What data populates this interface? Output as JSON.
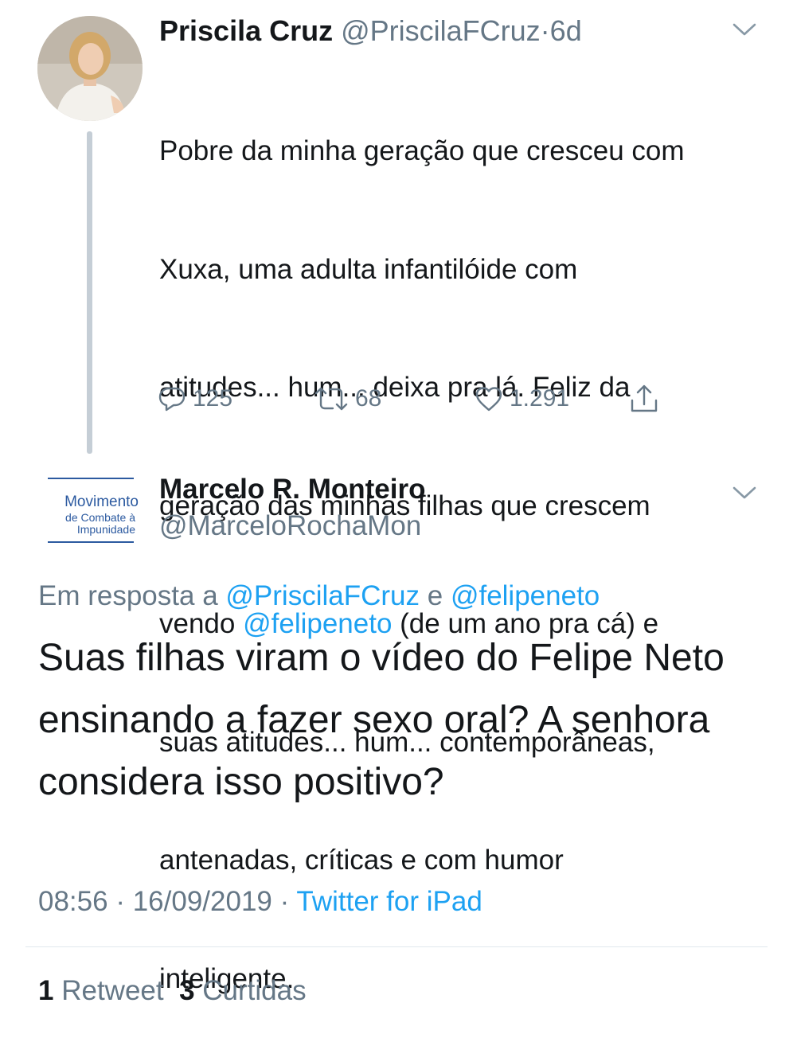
{
  "tweet1": {
    "author_name": "Priscila Cruz",
    "author_handle": "@PriscilaFCruz",
    "separator": "·",
    "time_ago": "6d",
    "body": {
      "line1": "Pobre da minha geração que cresceu com",
      "line2": "Xuxa, uma adulta infantilóide com",
      "line3": "atitudes... hum... deixa pra lá. Feliz da",
      "line4": "geração das minhas filhas que crescem",
      "line5_before": "vendo ",
      "line5_mention": "@felipeneto",
      "line5_after": " (de um ano pra cá) e",
      "line6": "suas atitudes... hum... contemporâneas,",
      "line7": "antenadas, críticas e com humor",
      "line8": "inteligente."
    },
    "replies": "125",
    "retweets": "68",
    "likes": "1.291",
    "icons": {
      "reply": "reply-icon",
      "retweet": "retweet-icon",
      "like": "heart-icon",
      "share": "share-icon",
      "menu": "chevron-down-icon"
    }
  },
  "tweet2": {
    "author_name": "Marcelo R. Monteiro",
    "author_handle": "@MarceloRochaMon",
    "avatar_text": {
      "line1": "Movimento",
      "line2": "de Combate à",
      "line3": "Impunidade"
    },
    "reply_prefix": "Em resposta a",
    "reply_mention1": "@PriscilaFCruz",
    "reply_conjunction": "e",
    "reply_mention2": "@felipeneto",
    "body": {
      "line1": "Suas filhas viram o vídeo do Felipe Neto",
      "line2": "ensinando a fazer sexo oral? A senhora",
      "line3": "considera isso positivo?"
    },
    "time": "08:56",
    "date": "16/09/2019",
    "separator": "·",
    "source": "Twitter for iPad",
    "retweet_count": "1",
    "retweet_label": "Retweet",
    "like_count": "3",
    "like_label": "Curtidas"
  },
  "colors": {
    "text": "#14171a",
    "secondary": "#657786",
    "link": "#1da1f2",
    "thread_line": "#c5ced6",
    "divider": "#e1e8ed",
    "logo_blue": "#2c5aa0"
  }
}
